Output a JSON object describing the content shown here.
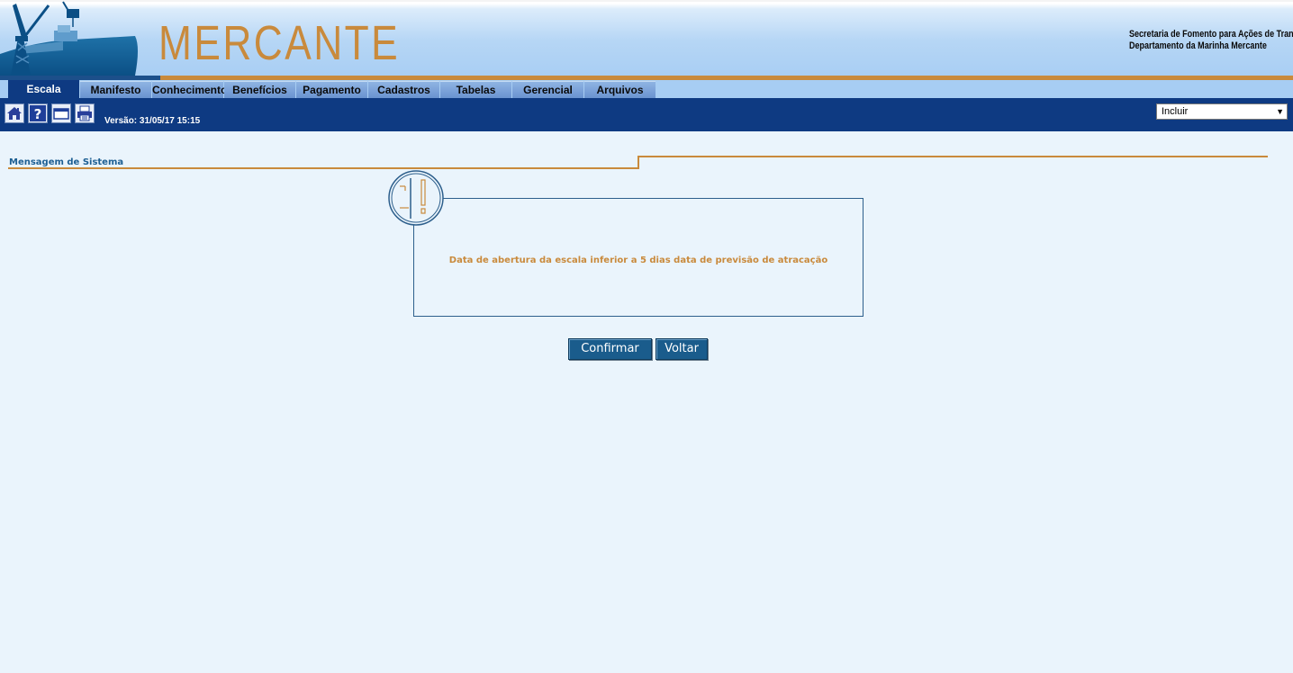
{
  "header": {
    "logo": "MERCANTE",
    "org_line1": "Secretaria de Fomento para Ações de Transportes",
    "org_line2": "Departamento da Marinha Mercante"
  },
  "tabs": [
    {
      "label": "Escala",
      "active": true
    },
    {
      "label": "Manifesto",
      "active": false
    },
    {
      "label": "Conhecimento",
      "active": false
    },
    {
      "label": "Benefícios",
      "active": false
    },
    {
      "label": "Pagamento",
      "active": false
    },
    {
      "label": "Cadastros",
      "active": false
    },
    {
      "label": "Tabelas",
      "active": false
    },
    {
      "label": "Gerencial",
      "active": false
    },
    {
      "label": "Arquivos",
      "active": false
    }
  ],
  "toolbar": {
    "icons": [
      "home-icon",
      "help-icon",
      "window-icon",
      "print-icon"
    ],
    "version": "Versão: 31/05/17 15:15",
    "action_select": {
      "selected": "Incluir"
    }
  },
  "section": {
    "title": "Mensagem de Sistema"
  },
  "message": {
    "icon": "alert-icon",
    "text": "Data de abertura da escala inferior a 5 dias data de previsão de atracação"
  },
  "buttons": {
    "confirm": "Confirmar",
    "back": "Voltar"
  },
  "colors": {
    "navy": "#0e3a82",
    "gold": "#c98a3c",
    "page_bg": "#eaf4fc",
    "button": "#1a5c8c"
  }
}
